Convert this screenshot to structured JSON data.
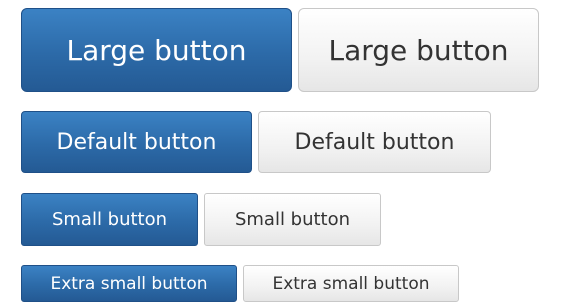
{
  "buttons": {
    "large": {
      "primary_label": "Large button",
      "secondary_label": "Large button"
    },
    "default": {
      "primary_label": "Default button",
      "secondary_label": "Default button"
    },
    "small": {
      "primary_label": "Small button",
      "secondary_label": "Small button"
    },
    "extra_small": {
      "primary_label": "Extra small button",
      "secondary_label": "Extra small button"
    }
  },
  "colors": {
    "primary_background": "#2c6aa8",
    "primary_text": "#ffffff",
    "secondary_background": "#f2f2f2",
    "secondary_text": "#333333"
  }
}
